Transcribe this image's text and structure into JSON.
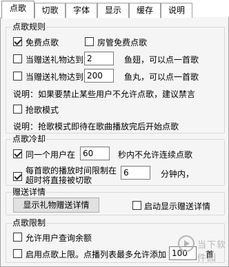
{
  "tabs": [
    "点歌",
    "切歌",
    "字体",
    "显示",
    "缓存",
    "说明"
  ],
  "rules": {
    "title": "点歌规则",
    "free_label": "免费点歌",
    "free_checked": true,
    "admin_free_label": "房管免费点歌",
    "admin_free_checked": false,
    "gift_a_prefix": "当赠送礼物达到",
    "gift_a_value": "2",
    "gift_a_suffix": "鱼翅，可以点一首歌",
    "gift_a_checked": false,
    "gift_b_prefix": "当赠送礼物达到",
    "gift_b_value": "200",
    "gift_b_suffix": "鱼丸，可以点一首歌",
    "gift_b_checked": false,
    "note1": "说明：如果要禁止某些用户不允许点歌，建议禁言",
    "grab_label": "抢歌模式",
    "grab_checked": false,
    "note2": "说明：抢歌模式即待在歌曲播放完后开始点歌"
  },
  "cooldown": {
    "title": "点歌冷却",
    "same_user_prefix": "同一个用户在",
    "same_user_value": "60",
    "same_user_suffix": "秒内不允许连续点歌",
    "same_user_checked": true,
    "time_limit_line1": "每首歌的播放时间限制在",
    "time_limit_line2": "超时将直接被切歌",
    "time_limit_value": "6",
    "time_limit_suffix": "分钟内，",
    "time_limit_checked": true
  },
  "gifts": {
    "title": "赠送详情",
    "show_button": "显示礼物赠送详情",
    "auto_show_label": "启动显示赠送详情",
    "auto_show_checked": false
  },
  "limits": {
    "title": "点歌限制",
    "balance_label": "允许用户查询余额",
    "balance_checked": false,
    "cap_prefix": "启用点歌上限。点播列表最多允许添加",
    "cap_value": "100",
    "cap_suffix": "首",
    "cap_checked": false
  },
  "watermark": {
    "text": "当下软件园"
  }
}
